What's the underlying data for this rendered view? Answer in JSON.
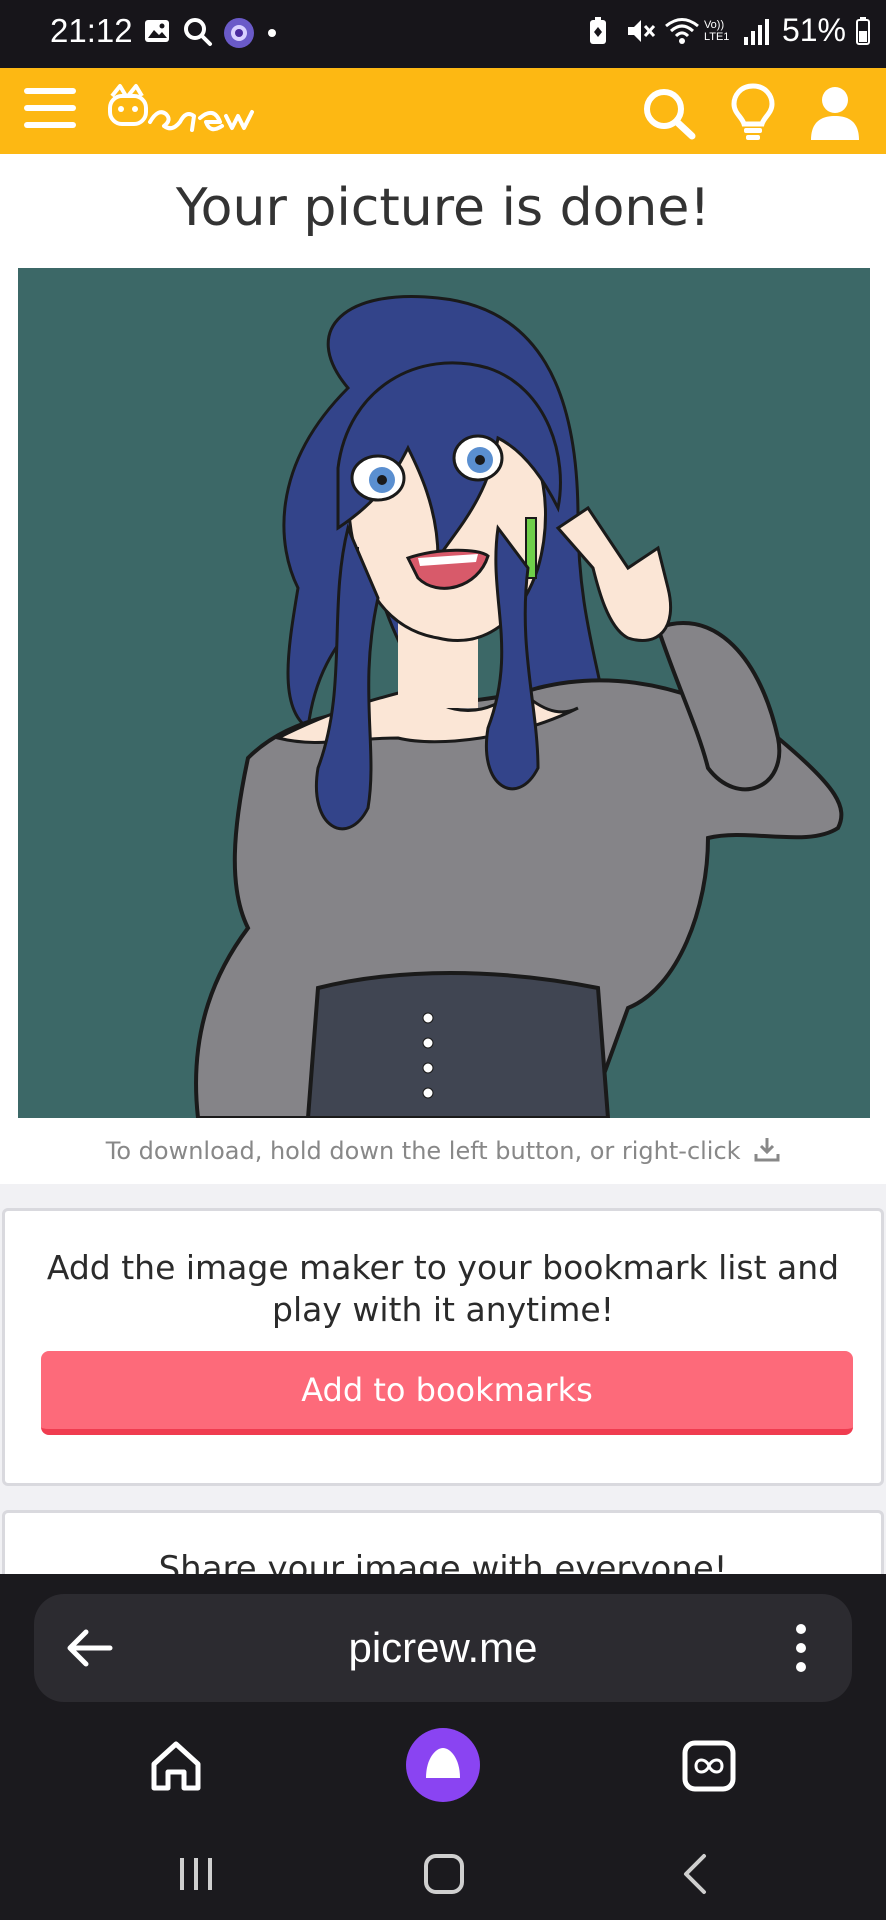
{
  "status_bar": {
    "time": "21:12",
    "battery": "51%",
    "left_icons": [
      "gallery-icon",
      "search-icon",
      "app-avatar-icon",
      "dot-icon"
    ],
    "right_icons": [
      "battery-saver-icon",
      "mute-icon",
      "wifi-icon",
      "volte-icon",
      "signal-icon",
      "battery-icon"
    ],
    "volte_text": "Vo)) LTE1"
  },
  "header": {
    "brand_color": "#fdb813",
    "logo_text": "Picrew",
    "icons": [
      "menu-icon",
      "search-icon",
      "lightbulb-icon",
      "user-icon"
    ]
  },
  "main": {
    "title": "Your picture is done!",
    "image_bg_color": "#3c6867",
    "download_hint": "To download, hold down the left button, or right-click",
    "bookmark": {
      "text": "Add the image maker to your bookmark list and play with it anytime!",
      "button_label": "Add to bookmarks",
      "button_color": "#fd6a7a"
    },
    "share": {
      "text": "Share your image with everyone!"
    }
  },
  "browser": {
    "url": "picrew.me",
    "accent_color": "#8a44f2",
    "icons": [
      "back-arrow-icon",
      "more-options-icon",
      "home-icon",
      "assistant-icon",
      "tabs-icon"
    ]
  },
  "system_nav": {
    "icons": [
      "recents-icon",
      "home-icon",
      "back-icon"
    ]
  }
}
